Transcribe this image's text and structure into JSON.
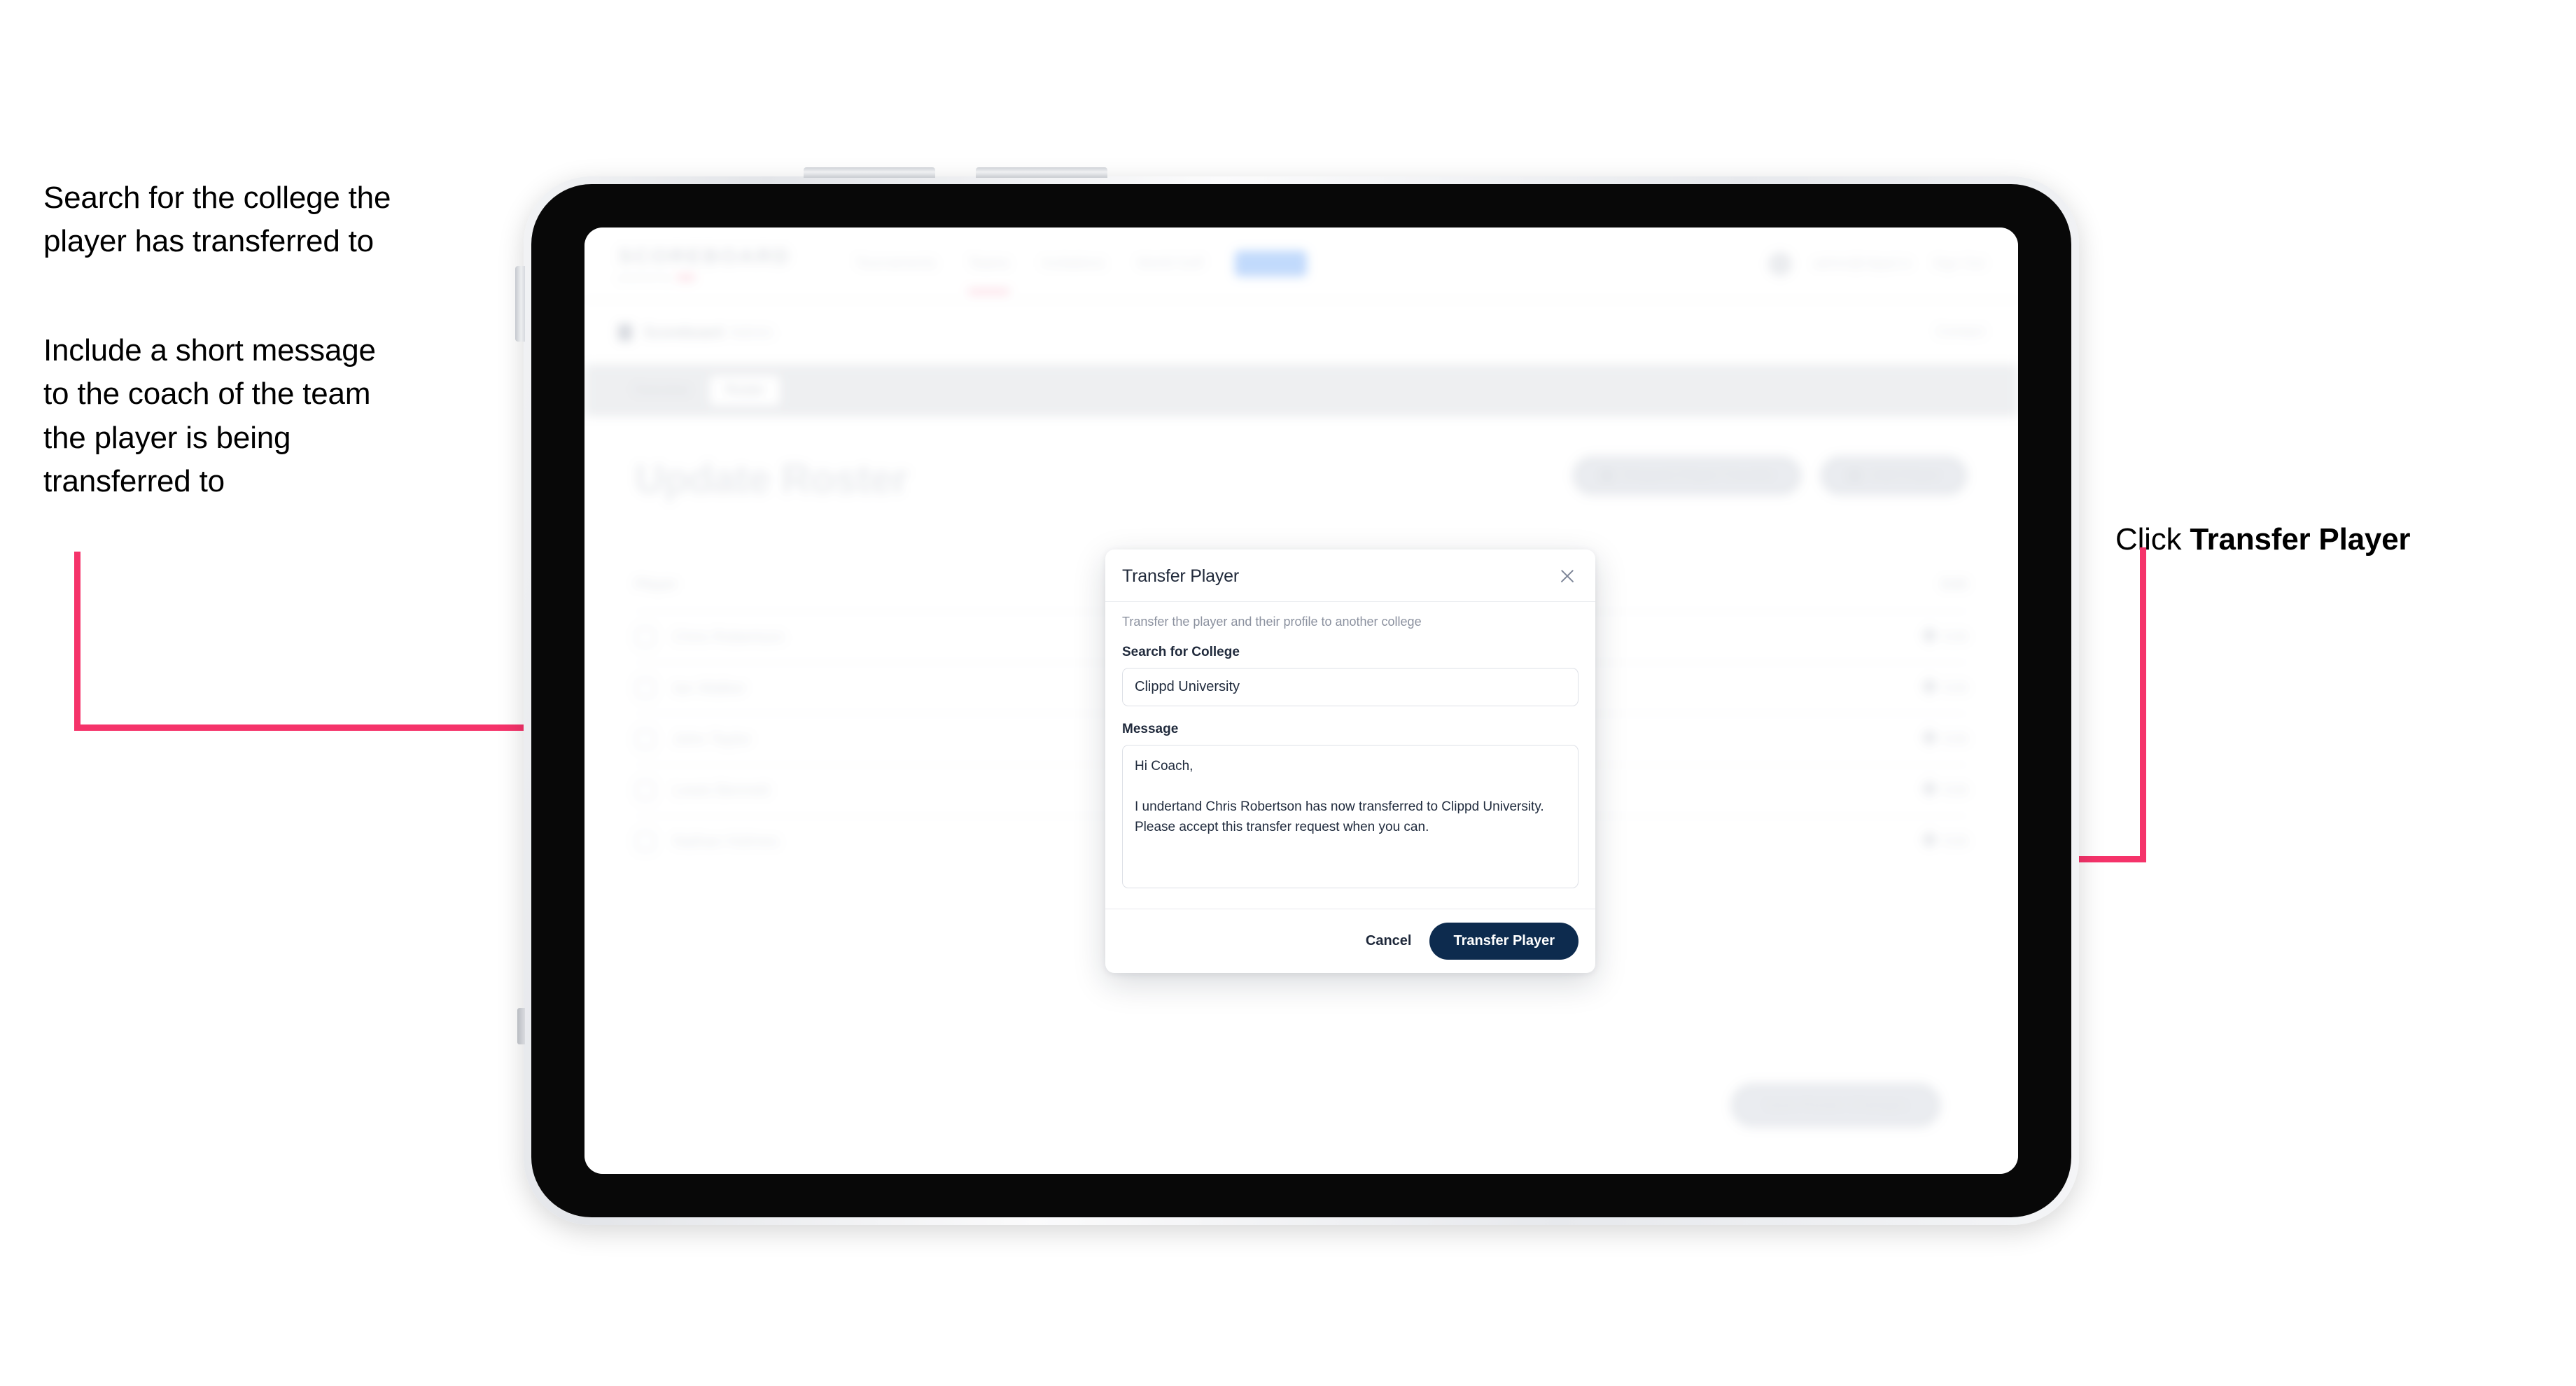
{
  "annotations": {
    "left_1": "Search for the college the\nplayer has transferred to",
    "left_2": "Include a short message\nto the coach of the team\nthe player is being\ntransferred to",
    "right_prefix": "Click ",
    "right_strong": "Transfer Player",
    "accent_color": "#f5336a"
  },
  "app": {
    "brand": {
      "name": "SCOREBOARD",
      "tagline": "powered by",
      "accent": "#f7b8c8"
    },
    "nav": [
      {
        "label": "Tournaments"
      },
      {
        "label": "Teams"
      },
      {
        "label": "Invitations"
      },
      {
        "label": "World Golf"
      },
      {
        "label": "Roster"
      }
    ],
    "top_right": {
      "account": "admin@clippd.io",
      "signout": "Sign Out"
    },
    "breadcrumb": {
      "main": "Scoreboard",
      "sub": "Admin",
      "right": "Contact"
    },
    "tabs": [
      {
        "label": "Overview",
        "active": false
      },
      {
        "label": "Roster",
        "active": true
      }
    ],
    "page_heading": "Update Roster",
    "roster_actions": [
      {
        "label": "Request Player Transfer",
        "icon": "transfer-icon"
      },
      {
        "label": "Add Player",
        "icon": "plus-icon"
      }
    ],
    "table": {
      "columns": [
        "Player",
        "Edit"
      ],
      "rows": [
        {
          "name": "Chris Robertson",
          "edit": "Edit"
        },
        {
          "name": "Ian Walker",
          "edit": "Edit"
        },
        {
          "name": "John Taylor",
          "edit": "Edit"
        },
        {
          "name": "Lewis Bennett",
          "edit": "Edit"
        },
        {
          "name": "Nathan Holmes",
          "edit": "Edit"
        }
      ]
    },
    "bottom_cta": "Save Roster Changes"
  },
  "modal": {
    "title": "Transfer Player",
    "close_icon": "close-icon",
    "description": "Transfer the player and their profile to another college",
    "college_label": "Search for College",
    "college_value": "Clippd University",
    "college_placeholder": "Search for College",
    "message_label": "Message",
    "message_value": "Hi Coach,\n\nI undertand Chris Robertson has now transferred to Clippd University. Please accept this transfer request when you can.",
    "message_placeholder": "Message",
    "cancel_label": "Cancel",
    "submit_label": "Transfer Player",
    "submit_color": "#0d2b4e"
  }
}
